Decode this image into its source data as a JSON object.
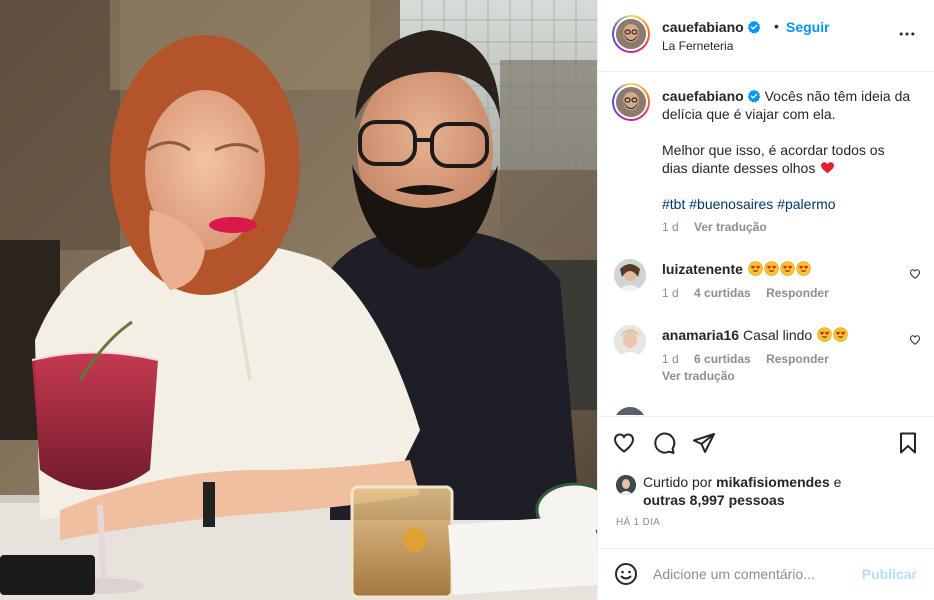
{
  "post": {
    "username": "cauefabiano",
    "follow_label": "Seguir",
    "dot": "•",
    "location": "La Ferneteria",
    "photo_alt": "Casal sentado à mesa de um bar com drinks"
  },
  "caption": {
    "username": "cauefabiano",
    "line1": "Vocês não têm ideia da delícia que é viajar com ela.",
    "line2": "Melhor que isso, é acordar todos os dias diante desses olhos",
    "hashtags": "#tbt #buenosaires #palermo",
    "time": "1 d",
    "translate": "Ver tradução"
  },
  "comments": [
    {
      "username": "luizatenente",
      "text": "",
      "emoji_count": 4,
      "time": "1 d",
      "likes": "4 curtidas",
      "reply": "Responder"
    },
    {
      "username": "anamaria16",
      "text": "Casal lindo",
      "emoji_count": 2,
      "time": "1 d",
      "likes": "6 curtidas",
      "reply": "Responder",
      "translate": "Ver tradução"
    }
  ],
  "likes": {
    "prefix": "Curtido por",
    "user": "mikafisiomendes",
    "conj": "e",
    "others": "outras 8,997 pessoas"
  },
  "posted_ago": "HÁ 1 DIA",
  "add_comment": {
    "placeholder": "Adicione um comentário...",
    "publish": "Publicar"
  },
  "colors": {
    "accent": "#0095f6",
    "hashtag": "#00376b",
    "publish_disabled": "#b2dffc",
    "heart": "#ed4956"
  },
  "icons": [
    "more-icon",
    "verified-icon",
    "heart-icon",
    "comment-icon",
    "share-icon",
    "save-icon",
    "emoji-icon",
    "heart-eyes-emoji"
  ]
}
